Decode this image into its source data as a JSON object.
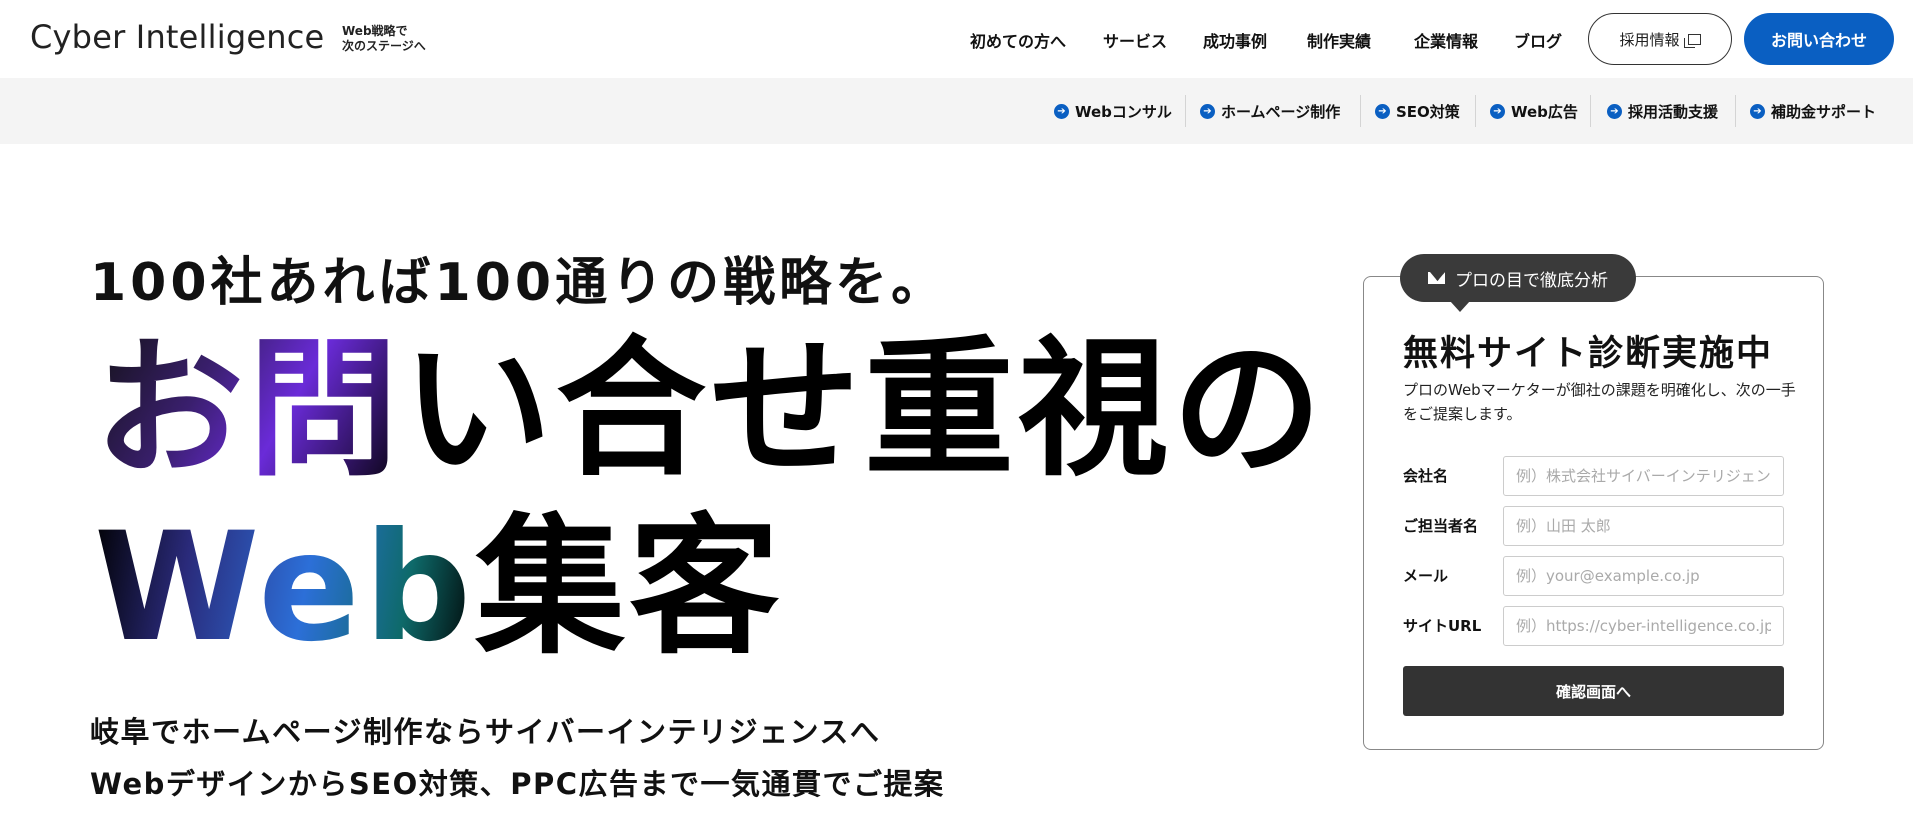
{
  "header": {
    "logo": "Cyber Intelligence",
    "tagline_line1": "Web戦略で",
    "tagline_line2": "次のステージへ",
    "nav": [
      "初めての方へ",
      "サービス",
      "成功事例",
      "制作実績",
      "企業情報",
      "ブログ"
    ],
    "recruit_label": "採用情報",
    "contact_label": "お問い合わせ"
  },
  "subnav": {
    "items": [
      "Webコンサル",
      "ホームページ制作",
      "SEO対策",
      "Web広告",
      "採用活動支援",
      "補助金サポート"
    ]
  },
  "hero": {
    "catch": "100社あれば100通りの戦略を。",
    "title1_grad": "お問",
    "title1_rest": "い合せ重視の",
    "title2_grad": "Web",
    "title2_rest": "集客",
    "desc_line1": "岐阜でホームページ制作ならサイバーインテリジェンスへ",
    "desc_line2": "WebデザインからSEO対策、PPC広告まで一気通貫でご提案"
  },
  "form": {
    "badge": "プロの目で徹底分析",
    "title": "無料サイト診断実施中",
    "text": "プロのWebマーケターが御社の課題を明確化し、次の一手をご提案します。",
    "fields": [
      {
        "label": "会社名",
        "placeholder": "例）株式会社サイバーインテリジェンス"
      },
      {
        "label": "ご担当者名",
        "placeholder": "例）山田 太郎"
      },
      {
        "label": "メール",
        "placeholder": "例）your@example.co.jp"
      },
      {
        "label": "サイトURL",
        "placeholder": "例）https://cyber-intelligence.co.jp"
      }
    ],
    "submit_label": "確認画面へ"
  },
  "colors": {
    "accent": "#0a5fc2",
    "dark": "#333333",
    "subnav_bg": "#f4f4f4"
  },
  "icons": {
    "subnav_arrow": "arrow-right-circle-icon",
    "recruit": "external-window-icon",
    "badge": "mail-icon"
  }
}
